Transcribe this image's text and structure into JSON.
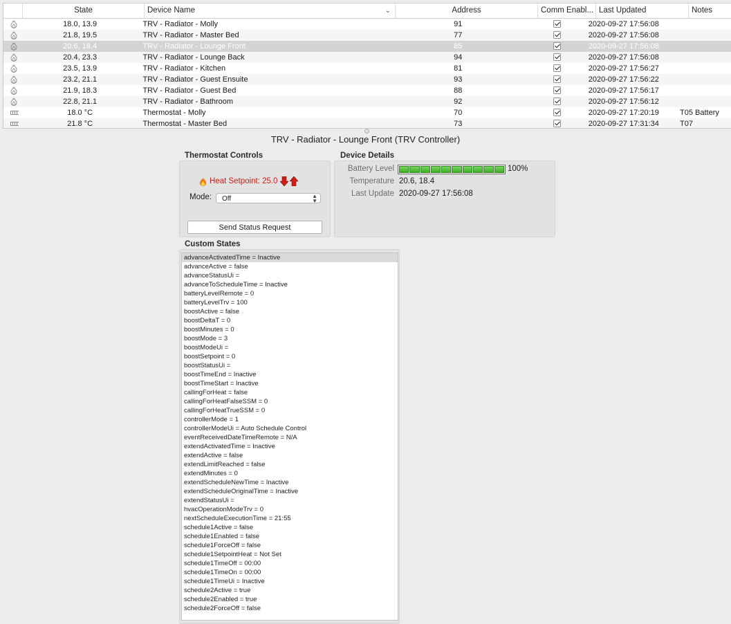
{
  "table": {
    "columns": {
      "state": "State",
      "name": "Device Name",
      "address": "Address",
      "comm": "Comm Enabl...",
      "updated": "Last Updated",
      "notes": "Notes"
    },
    "rows": [
      {
        "icon": "flame-icon",
        "state": "18.0, 13.9",
        "name": "TRV - Radiator - Molly",
        "address": "91",
        "comm": true,
        "updated": "2020-09-27 17:56:08",
        "notes": ""
      },
      {
        "icon": "flame-icon",
        "state": "21.8, 19.5",
        "name": "TRV - Radiator - Master Bed",
        "address": "77",
        "comm": true,
        "updated": "2020-09-27 17:56:08",
        "notes": ""
      },
      {
        "icon": "flame-icon",
        "state": "20.6, 18.4",
        "name": "TRV - Radiator - Lounge Front",
        "address": "85",
        "comm": true,
        "updated": "2020-09-27 17:56:08",
        "notes": "",
        "selected": true
      },
      {
        "icon": "flame-icon",
        "state": "20.4, 23.3",
        "name": "TRV - Radiator - Lounge Back",
        "address": "94",
        "comm": true,
        "updated": "2020-09-27 17:56:08",
        "notes": ""
      },
      {
        "icon": "flame-icon",
        "state": "23.5, 13.9",
        "name": "TRV - Radiator - Kitchen",
        "address": "81",
        "comm": true,
        "updated": "2020-09-27 17:56:27",
        "notes": ""
      },
      {
        "icon": "flame-icon",
        "state": "23.2, 21.1",
        "name": "TRV - Radiator - Guest Ensuite",
        "address": "93",
        "comm": true,
        "updated": "2020-09-27 17:56:22",
        "notes": ""
      },
      {
        "icon": "flame-icon",
        "state": "21.9, 18.3",
        "name": "TRV - Radiator - Guest Bed",
        "address": "88",
        "comm": true,
        "updated": "2020-09-27 17:56:17",
        "notes": ""
      },
      {
        "icon": "flame-icon",
        "state": "22.8, 21.1",
        "name": "TRV - Radiator - Bathroom",
        "address": "92",
        "comm": true,
        "updated": "2020-09-27 17:56:12",
        "notes": ""
      },
      {
        "icon": "thermostat-grid-icon",
        "state": "18.0 °C",
        "name": "Thermostat - Molly",
        "address": "70",
        "comm": true,
        "updated": "2020-09-27 17:20:19",
        "notes": "T05 Battery"
      },
      {
        "icon": "thermostat-grid-icon",
        "state": "21.8 °C",
        "name": "Thermostat - Master Bed",
        "address": "73",
        "comm": true,
        "updated": "2020-09-27 17:31:34",
        "notes": "T07"
      }
    ]
  },
  "device_title": "TRV - Radiator - Lounge Front (TRV Controller)",
  "thermostat": {
    "section_label": "Thermostat Controls",
    "heat_setpoint": "Heat Setpoint: 25.0",
    "mode_label": "Mode:",
    "mode_value": "Off",
    "send_button": "Send Status Request"
  },
  "details": {
    "section_label": "Device Details",
    "battery_label": "Battery Level",
    "battery_value": "100%",
    "battery_level": 1.0,
    "temperature_label": "Temperature",
    "temperature_value": "20.6, 18.4",
    "last_update_label": "Last Update",
    "last_update_value": "2020-09-27 17:56:08"
  },
  "custom_states": {
    "section_label": "Custom States",
    "items": [
      "advanceActivatedTime = Inactive",
      "advanceActive = false",
      "advanceStatusUi =",
      "advanceToScheduleTime = Inactive",
      "batteryLevelRemote = 0",
      "batteryLevelTrv = 100",
      "boostActive = false",
      "boostDeltaT = 0",
      "boostMinutes = 0",
      "boostMode = 3",
      "boostModeUi =",
      "boostSetpoint = 0",
      "boostStatusUi =",
      "boostTimeEnd = Inactive",
      "boostTimeStart = Inactive",
      "callingForHeat = false",
      "callingForHeatFalseSSM = 0",
      "callingForHeatTrueSSM = 0",
      "controllerMode = 1",
      "controllerModeUi = Auto Schedule Control",
      "eventReceivedDateTimeRemote = N/A",
      "extendActivatedTime = Inactive",
      "extendActive = false",
      "extendLimitReached = false",
      "extendMinutes = 0",
      "extendScheduleNewTime = Inactive",
      "extendScheduleOriginalTime = Inactive",
      "extendStatusUi =",
      "hvacOperationModeTrv = 0",
      "nextScheduleExecutionTime = 21:55",
      "schedule1Active = false",
      "schedule1Enabled = false",
      "schedule1ForceOff = false",
      "schedule1SetpointHeat = Not Set",
      "schedule1TimeOff = 00:00",
      "schedule1TimeOn = 00:00",
      "schedule1TimeUi = Inactive",
      "schedule2Active = true",
      "schedule2Enabled = true",
      "schedule2ForceOff = false"
    ]
  },
  "colors": {
    "selection_row": "#d4d4d4",
    "heat_text": "#c0211a",
    "battery_fill": "#4cbb34"
  }
}
